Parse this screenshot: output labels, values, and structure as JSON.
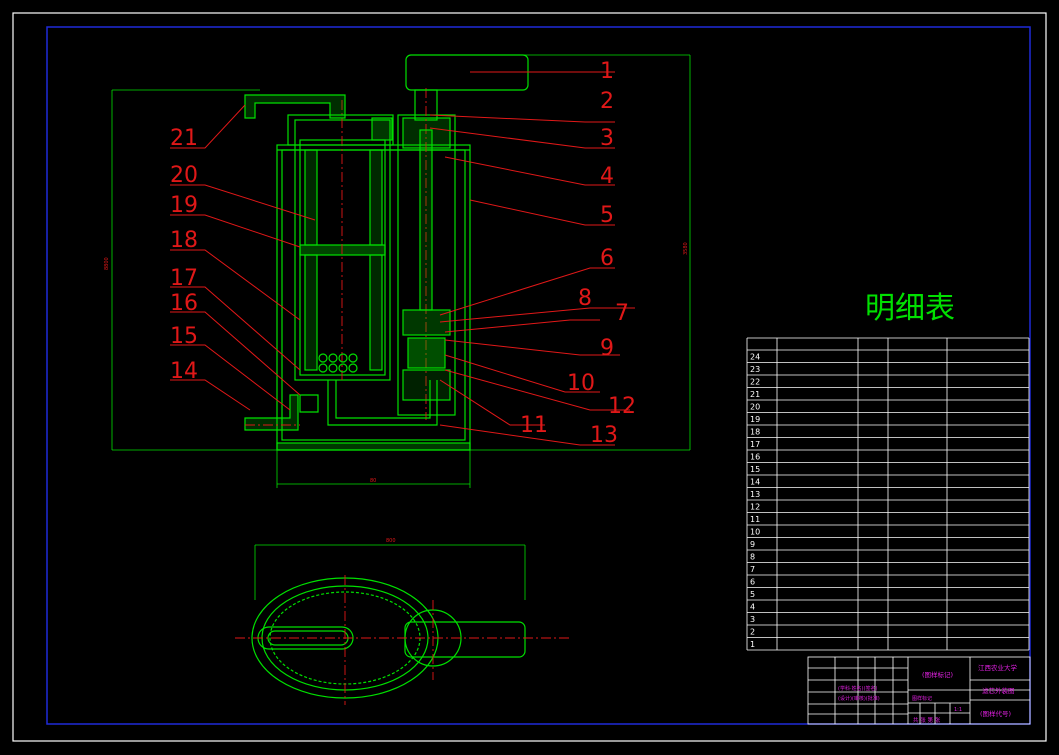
{
  "drawing": {
    "parts_list_title": "明细表",
    "callouts": [
      "1",
      "2",
      "3",
      "4",
      "5",
      "6",
      "7",
      "8",
      "9",
      "10",
      "11",
      "12",
      "13",
      "14",
      "15",
      "16",
      "17",
      "18",
      "19",
      "20",
      "21"
    ],
    "dimensions": {
      "overall_height_left": "8800",
      "overall_height_right": "3580",
      "base_width": "80",
      "plan_width": "800"
    },
    "bom_row_numbers": [
      "24",
      "23",
      "22",
      "21",
      "20",
      "19",
      "18",
      "17",
      "16",
      "15",
      "14",
      "13",
      "12",
      "11",
      "10",
      "9",
      "8",
      "7",
      "6",
      "5",
      "4",
      "3",
      "2",
      "1"
    ],
    "title_block": {
      "drawing_mark": "(图样标记)",
      "school": "江西农业大学",
      "drawing_name": "滤芯外装图",
      "drawing_code": "(图样代号)",
      "scale": "1:1",
      "sheet_info": "共 张 第 张",
      "weight_label": "图样标记",
      "row1": "(学科·姓名)(签名)",
      "row2": "(设计)(审核)(批准)"
    }
  },
  "colors": {
    "background": "#000000",
    "frame": "#1f2bd9",
    "outline": "#00e000",
    "leader": "#e01818",
    "table": "#ffffff",
    "title_text": "#e020e0"
  }
}
